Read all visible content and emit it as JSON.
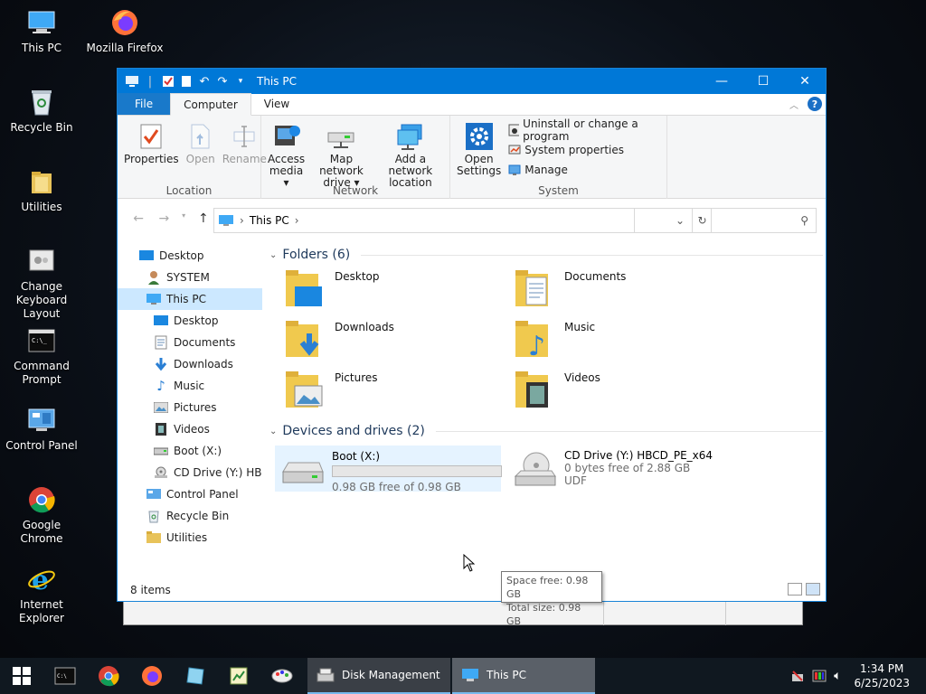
{
  "desktop": {
    "icons": [
      {
        "label": "This PC",
        "icon": "this-pc-icon"
      },
      {
        "label": "Mozilla Firefox",
        "icon": "firefox-icon"
      },
      {
        "label": "Recycle Bin",
        "icon": "recycle-bin-icon"
      },
      {
        "label": "Utilities",
        "icon": "folder-icon"
      },
      {
        "label": "Change Keyboard Layout",
        "icon": "keyboard-layout-icon"
      },
      {
        "label": "Command Prompt",
        "icon": "command-prompt-icon"
      },
      {
        "label": "Control Panel",
        "icon": "control-panel-icon"
      },
      {
        "label": "Google Chrome",
        "icon": "chrome-icon"
      },
      {
        "label": "Internet Explorer",
        "icon": "internet-explorer-icon"
      }
    ]
  },
  "window": {
    "title": "This PC",
    "accent": "#0078d7",
    "tabs": {
      "file": "File",
      "computer": "Computer",
      "view": "View"
    },
    "ribbon": {
      "location": {
        "name": "Location",
        "properties": "Properties",
        "open": "Open",
        "rename": "Rename"
      },
      "network": {
        "name": "Network",
        "access_media_1": "Access",
        "access_media_2": "media",
        "map_drive_1": "Map network",
        "map_drive_2": "drive",
        "add_location_1": "Add a network",
        "add_location_2": "location"
      },
      "system": {
        "name": "System",
        "open_settings_1": "Open",
        "open_settings_2": "Settings",
        "uninstall": "Uninstall or change a program",
        "system_properties": "System properties",
        "manage": "Manage"
      }
    },
    "address": {
      "path": "This PC",
      "search_placeholder": ""
    },
    "nav_pane": [
      {
        "label": "Desktop"
      },
      {
        "label": "SYSTEM"
      },
      {
        "label": "This PC"
      },
      {
        "label": "Desktop"
      },
      {
        "label": "Documents"
      },
      {
        "label": "Downloads"
      },
      {
        "label": "Music"
      },
      {
        "label": "Pictures"
      },
      {
        "label": "Videos"
      },
      {
        "label": "Boot (X:)"
      },
      {
        "label": "CD Drive (Y:) HBC"
      },
      {
        "label": "Control Panel"
      },
      {
        "label": "Recycle Bin"
      },
      {
        "label": "Utilities"
      }
    ],
    "folders": {
      "header": "Folders (6)",
      "items": [
        "Desktop",
        "Documents",
        "Downloads",
        "Music",
        "Pictures",
        "Videos"
      ]
    },
    "devices": {
      "header": "Devices and drives (2)",
      "boot": {
        "name": "Boot (X:)",
        "free": "0.98 GB free of 0.98 GB",
        "used_fraction": 0.0
      },
      "cd": {
        "name": "CD Drive (Y:) HBCD_PE_x64",
        "free": "0 bytes free of 2.88 GB",
        "fs": "UDF"
      }
    },
    "tooltip": {
      "line1": "Space free: 0.98 GB",
      "line2": "Total size: 0.98 GB"
    },
    "status": "8 items"
  },
  "taskbar": {
    "tasks": [
      {
        "label": "Disk Management"
      },
      {
        "label": "This PC"
      }
    ],
    "time": "1:34 PM",
    "date": "6/25/2023"
  }
}
